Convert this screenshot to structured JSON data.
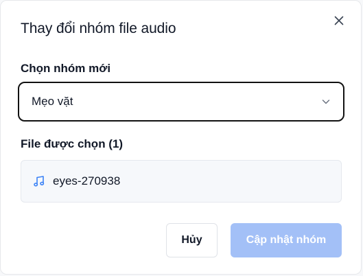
{
  "dialog": {
    "title": "Thay đổi nhóm file audio",
    "close_icon": "close-icon"
  },
  "group_select": {
    "label": "Chọn nhóm mới",
    "selected_value": "Mẹo vặt",
    "icon": "chevron-down-icon"
  },
  "selected_files": {
    "label": "File được chọn (1)",
    "items": [
      {
        "name": "eyes-270938",
        "icon": "music-note-icon"
      }
    ]
  },
  "actions": {
    "cancel_label": "Hủy",
    "update_label": "Cập nhật nhóm",
    "update_disabled": true
  },
  "colors": {
    "primary_disabled": "#a3c0f7",
    "icon_blue": "#3b82f6",
    "select_border": "#111111"
  }
}
